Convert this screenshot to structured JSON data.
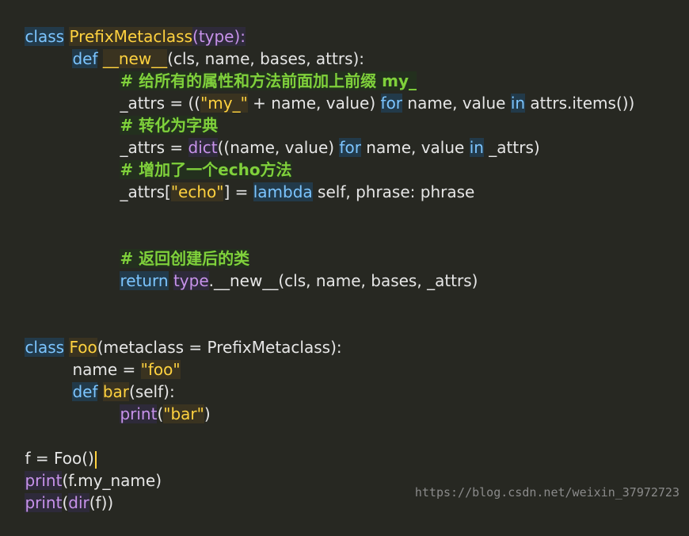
{
  "watermark": "https://blog.csdn.net/weixin_37972723",
  "code": {
    "l1": {
      "kw": "class",
      "name": "PrefixMetaclass",
      "open": "(",
      "base": "type",
      "close": "):"
    },
    "l2": {
      "kw": "def",
      "name": "__new__",
      "rest": "(cls, name, bases, attrs):"
    },
    "l3": {
      "comment": "# 给所有的属性和方法前面加上前缀 my_"
    },
    "l4": {
      "a": "_attrs = ((",
      "s": "\"my_\"",
      "b": " + name, value) ",
      "kw1": "for",
      "c": " name, value ",
      "kw2": "in",
      "d": " attrs.items())"
    },
    "l5": {
      "comment": "# 转化为字典"
    },
    "l6": {
      "a": "_attrs = ",
      "fn": "dict",
      "b": "((name, value) ",
      "kw1": "for",
      "c": " name, value ",
      "kw2": "in",
      "d": " _attrs)"
    },
    "l7": {
      "comment": "# 增加了一个echo方法"
    },
    "l8": {
      "a": "_attrs[",
      "s": "\"echo\"",
      "b": "] = ",
      "kw": "lambda",
      "c": " self, phrase: phrase"
    },
    "l9": {
      "comment": "# 返回创建后的类"
    },
    "l10": {
      "kw": "return",
      "sp": " ",
      "fn": "type",
      "rest": ".__new__(cls, name, bases, _attrs)"
    },
    "l11": {
      "kw": "class",
      "name": "Foo",
      "rest": "(metaclass = PrefixMetaclass):"
    },
    "l12": {
      "a": "name = ",
      "s": "\"foo\""
    },
    "l13": {
      "kw": "def",
      "name": "bar",
      "rest": "(self):"
    },
    "l14": {
      "fn": "print",
      "open": "(",
      "s": "\"bar\"",
      "close": ")"
    },
    "l15": {
      "text": "f = Foo()"
    },
    "l16": {
      "fn": "print",
      "rest": "(f.my_name)"
    },
    "l17": {
      "fn": "print",
      "open": "(",
      "fn2": "dir",
      "rest": "(f))"
    }
  }
}
